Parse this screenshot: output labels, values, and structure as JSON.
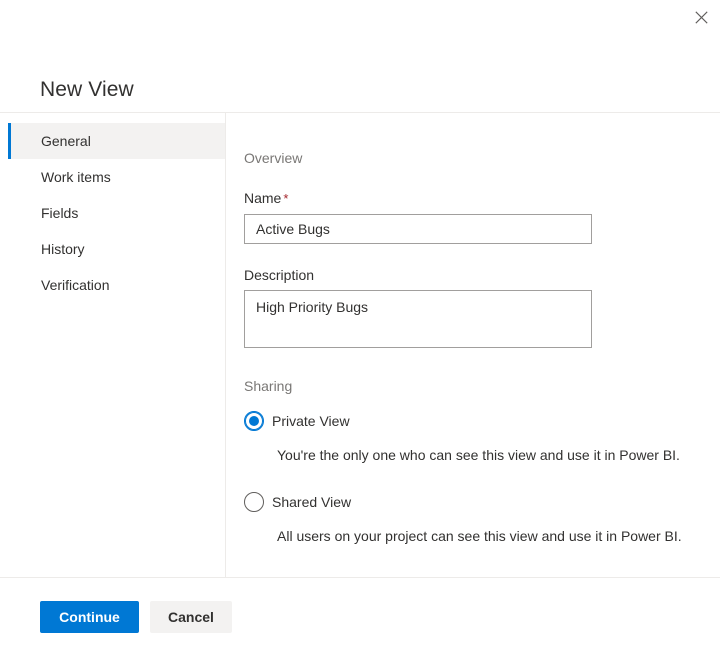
{
  "dialog": {
    "title": "New View",
    "close_icon": "close-icon"
  },
  "nav": {
    "items": [
      {
        "label": "General",
        "selected": true
      },
      {
        "label": "Work items",
        "selected": false
      },
      {
        "label": "Fields",
        "selected": false
      },
      {
        "label": "History",
        "selected": false
      },
      {
        "label": "Verification",
        "selected": false
      }
    ]
  },
  "overview": {
    "section_label": "Overview",
    "name": {
      "label": "Name",
      "required_mark": "*",
      "value": "Active Bugs",
      "placeholder": ""
    },
    "description": {
      "label": "Description",
      "value": "High Priority Bugs",
      "placeholder": ""
    }
  },
  "sharing": {
    "section_label": "Sharing",
    "options": [
      {
        "label": "Private View",
        "checked": true,
        "help": "You're the only one who can see this view and use it in Power BI."
      },
      {
        "label": "Shared View",
        "checked": false,
        "help": "All users on your project can see this view and use it in Power BI."
      }
    ]
  },
  "footer": {
    "continue_label": "Continue",
    "cancel_label": "Cancel"
  },
  "colors": {
    "accent": "#0078d4",
    "selected_row_bg": "#f3f2f1",
    "required_red": "#a4262c",
    "divider": "#edebe9",
    "input_border": "#a19f9d",
    "muted_text": "#797775",
    "body_text": "#323130"
  }
}
